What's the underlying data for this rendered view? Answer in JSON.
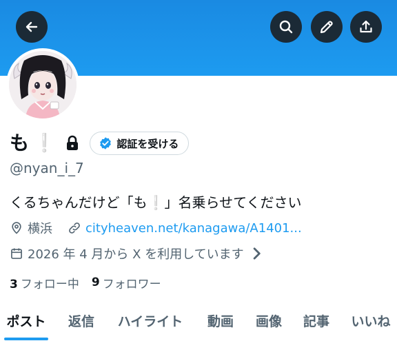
{
  "header": {
    "back_icon": "arrow-left-icon",
    "search_icon": "search-icon",
    "edit_icon": "pencil-icon",
    "share_icon": "share-icon",
    "banner_color": "#1d9bf0"
  },
  "profile": {
    "display_name": "も",
    "name_emoji": "❕",
    "lock_icon": "lock-icon",
    "verify_button_label": "認証を受ける",
    "handle": "@nyan_i_7",
    "bio_before": "くるちゃんだけど「も",
    "bio_emoji": "❕",
    "bio_after": "」名乗らせてください",
    "location": "横浜",
    "website": "cityheaven.net/kanagawa/A1401...",
    "joined": "2026 年 4 月から X を利用しています",
    "following_count": "3",
    "following_label": "フォロー中",
    "followers_count": "9",
    "followers_label": "フォロワー"
  },
  "tabs": [
    {
      "label": "ポスト",
      "active": true
    },
    {
      "label": "返信",
      "active": false
    },
    {
      "label": "ハイライト",
      "active": false
    },
    {
      "label": "動画",
      "active": false
    },
    {
      "label": "画像",
      "active": false
    },
    {
      "label": "記事",
      "active": false
    },
    {
      "label": "いいね",
      "active": false
    }
  ],
  "colors": {
    "accent": "#1d9bf0",
    "text": "#0f1419",
    "secondary": "#536471"
  }
}
